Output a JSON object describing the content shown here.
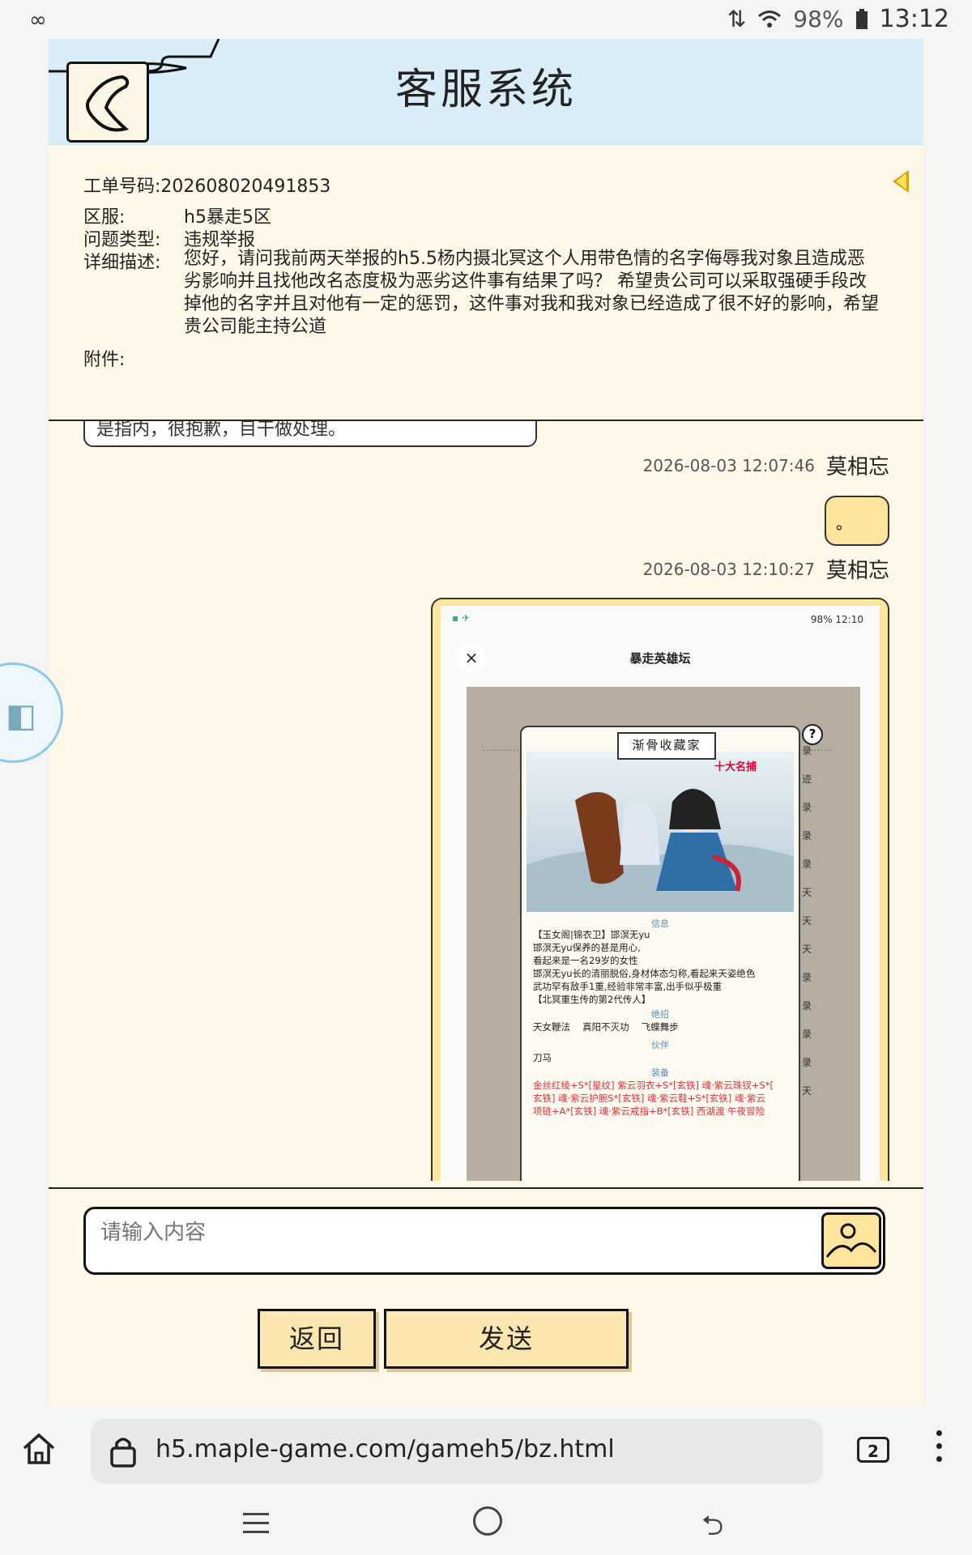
{
  "statusbar": {
    "battery": "98%",
    "time": "13:12"
  },
  "header": {
    "title": "客服系统"
  },
  "ticket": {
    "number_label": "工单号码:",
    "number": "202608020491853",
    "server_label": "区服:",
    "server": "h5暴走5区",
    "type_label": "问题类型:",
    "type": "违规举报",
    "desc_label": "详细描述:",
    "desc": "您好，请问我前两天举报的h5.5杨内摄北冥这个人用带色情的名字侮辱我对象且造成恶劣影响并且找他改名态度极为恶劣这件事有结果了吗？ 希望贵公司可以采取强硬手段改掉他的名字并且对他有一定的惩罚，这件事对我和我对象已经造成了很不好的影响，希望贵公司能主持公道",
    "attach_label": "附件:"
  },
  "chat": {
    "prev_partial": "是指内，很抱歉，目干做处理。",
    "messages": [
      {
        "time": "2026-08-03 12:07:46",
        "name": "莫相忘",
        "text": "。"
      },
      {
        "time": "2026-08-03 12:10:27",
        "name": "莫相忘"
      }
    ],
    "screenshot": {
      "battery_time": "98% 12:10",
      "title": "暴走英雄坛",
      "close": "×",
      "plaque": "渐骨收藏家",
      "plaque_sub": "十大名捕",
      "sec_info": "信息",
      "info_lines": [
        "【玉女阁|锦衣卫】邯溟无yu",
        "邯溟无yu保养的甚是用心,",
        "看起来是一名29岁的女性",
        "邯溟无yu长的清丽脱俗,身材体态匀称,看起来天姿绝色",
        "武功罕有敌手1重,经验非常丰富,出手似乎极重",
        "【北冥重生传的第2代传人】"
      ],
      "sec_skill": "绝招",
      "skills": "天女鞭法　 真阳不灭功　 飞蝶舞步",
      "sec_partner": "伙伴",
      "partner": "刀马",
      "sec_equip": "装备",
      "equip_lines": [
        "金丝红绫+S*[星纹] 紫云羽衣+S*[玄铁] 魂·紫云珠钗+S*[",
        "玄铁] 魂·紫云护腕S*[玄铁] 魂·紫云鞋+S*[玄铁] 魂·紫云",
        "项链+A*[玄铁] 魂·紫云戒指+B*[玄铁] 西湖渡 午夜冒险"
      ],
      "side_chars": [
        "录",
        "迹",
        "录",
        "录",
        "录",
        "天",
        "天",
        "天",
        "录",
        "录",
        "录",
        "录",
        "天"
      ],
      "help": "?"
    }
  },
  "input": {
    "placeholder": "请输入内容"
  },
  "buttons": {
    "back": "返回",
    "send": "发送"
  },
  "browser": {
    "url": "h5.maple-game.com/gameh5/bz.html",
    "tabs": "2"
  },
  "colors": {
    "header_bg": "#d9edf8",
    "page_bg": "#fef8e8",
    "bubble": "#ffe49e",
    "button": "#fbe6b0"
  }
}
